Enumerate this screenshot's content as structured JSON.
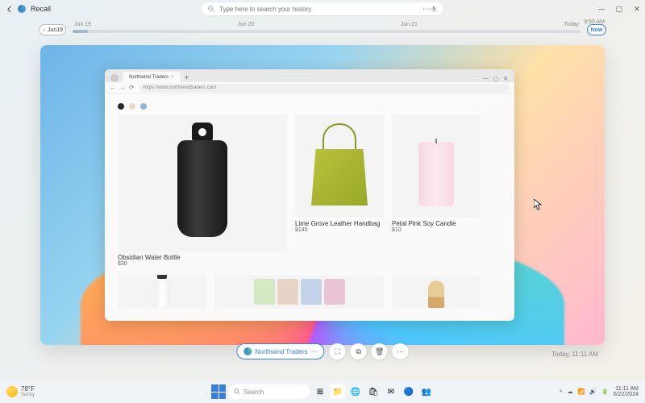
{
  "app": {
    "title": "Recall"
  },
  "search": {
    "placeholder": "Type here to search your history"
  },
  "timeline": {
    "back_label": "Jun19",
    "dates": [
      "Jun 19",
      "Jun 20",
      "Jun 21",
      "Today"
    ],
    "time": "9:50 AM",
    "now_label": "Now"
  },
  "browser": {
    "tab_title": "Northwind Traders",
    "url": "https://www.northwindtraders.com"
  },
  "products": {
    "hero": {
      "name": "Obsidian Water Bottle",
      "price": "$30"
    },
    "p1": {
      "name": "Lime Grove Leather Handbag",
      "price": "$140"
    },
    "p2": {
      "name": "Petal Pink Soy Candle",
      "price": "$10"
    }
  },
  "action": {
    "app_label": "Northwind Traders"
  },
  "snapshot": {
    "timestamp": "Today, 11:11 AM"
  },
  "taskbar": {
    "weather_temp": "78°F",
    "weather_cond": "Sunny",
    "search_label": "Search",
    "time": "11:11 AM",
    "date": "6/22/2024"
  }
}
